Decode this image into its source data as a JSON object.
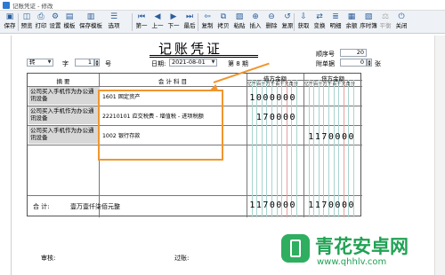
{
  "window": {
    "title": "记账凭证 - 修改"
  },
  "toolbar": {
    "buttons": [
      {
        "label": "保存",
        "icon": "save-icon"
      },
      {
        "label": "预览",
        "icon": "preview-icon"
      },
      {
        "label": "打印",
        "icon": "print-icon"
      },
      {
        "label": "设置",
        "icon": "settings-icon"
      },
      {
        "label": "模板",
        "icon": "template-icon"
      },
      {
        "label": "保存模板",
        "icon": "save-template-icon"
      },
      {
        "label": "选项",
        "icon": "options-icon"
      },
      {
        "label": "第一",
        "icon": "first-icon"
      },
      {
        "label": "上一",
        "icon": "prev-icon"
      },
      {
        "label": "下一",
        "icon": "next-icon"
      },
      {
        "label": "最后",
        "icon": "last-icon"
      },
      {
        "label": "复制",
        "icon": "copy-icon"
      },
      {
        "label": "拷贝",
        "icon": "duplicate-icon"
      },
      {
        "label": "粘贴",
        "icon": "paste-icon"
      },
      {
        "label": "插入",
        "icon": "insert-icon"
      },
      {
        "label": "删除",
        "icon": "delete-icon"
      },
      {
        "label": "复原",
        "icon": "restore-icon"
      },
      {
        "label": "获取",
        "icon": "fetch-icon"
      },
      {
        "label": "变换",
        "icon": "transform-icon"
      },
      {
        "label": "明细",
        "icon": "detail-icon"
      },
      {
        "label": "余额",
        "icon": "balance-icon"
      },
      {
        "label": "序时簿",
        "icon": "journal-icon"
      },
      {
        "label": "平衡",
        "icon": "balance-check-icon",
        "disabled": true
      },
      {
        "label": "关闭",
        "icon": "close-icon"
      }
    ]
  },
  "voucher": {
    "title": "记账凭证",
    "type_label": "字",
    "type_value": "转",
    "number_value": "1",
    "number_label": "号",
    "date_label": "日期:",
    "date_value": "2021-08-01",
    "period_text": "第 8 期",
    "seq_label": "顺序号",
    "seq_value": "20",
    "attach_label": "附单据",
    "attach_value": "0",
    "attach_unit": "张"
  },
  "table": {
    "headers": {
      "summary": "摘 要",
      "account": "会 计 科 目",
      "debit": "借方金额",
      "credit": "贷方金额",
      "digits": "亿千百十万千百十元角分"
    },
    "rows": [
      {
        "summary": "公司买入手机作为办公通讯设备",
        "account": "1601 固定资产",
        "debit": "1000000",
        "credit": ""
      },
      {
        "summary": "公司买入手机作为办公通讯设备",
        "account": "22210101 应交税费 - 增值税 - 进项税额",
        "debit": "170000",
        "credit": ""
      },
      {
        "summary": "公司买入手机作为办公通讯设备",
        "account": "1002 银行存款",
        "debit": "",
        "credit": "1170000"
      }
    ],
    "total_label": "合 计:",
    "total_words": "壹万壹仟柒佰元整",
    "total_debit": "1170000",
    "total_credit": "1170000"
  },
  "footer": {
    "reviewer_label": "审核:",
    "poster_label": "过账:"
  },
  "watermark": {
    "name": "青花安卓网",
    "url": "www.qhhlv.com"
  },
  "colors": {
    "highlight": "#f0962f",
    "toolbar_icon": "#2a5d9c",
    "watermark": "#20a254"
  }
}
